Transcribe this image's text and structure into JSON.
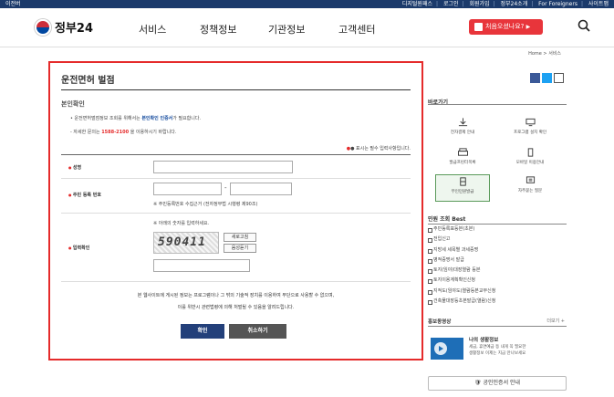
{
  "topbar": {
    "left": "이전버",
    "links": [
      "디지털원패스",
      "로그인",
      "회원가입",
      "정부24소개",
      "For Foreigners",
      "사이트맵"
    ]
  },
  "header": {
    "logo": "정부24",
    "nav": [
      "서비스",
      "정책정보",
      "기관정보",
      "고객센터"
    ],
    "cta": "처음오셨나요?",
    "search_icon": "search-icon"
  },
  "breadcrumb": "Home > 서비스",
  "main": {
    "title": "운전면허 벌점",
    "section": "본인확인",
    "desc1_pre": "운전면허벌점정보 조회를 위해서는 ",
    "desc1_link": "본인확인 인증서",
    "desc1_post": "가 필요합니다.",
    "desc2_pre": "- 자세한 문의는 ",
    "desc2_phone": "1588-2100",
    "desc2_post": " 을 이용하시기 바랍니다.",
    "required_note": "● 표시는 필수 입력사항입니다.",
    "fields": {
      "name_label": "성명",
      "rrn_label": "주민 등록 번호",
      "rrn_hint": "※ 주민등록번호 수집근거 (전자정부법 시행령 제90조)",
      "captcha_label": "입력확인",
      "captcha_hint": "※ 아래의 숫자를 입력하세요.",
      "captcha_text": "590411",
      "refresh_label": "새로고침",
      "audio_label": "음성듣기"
    },
    "notice1": "본 웹사이트에 게시된 정보는 프로그램이나 그 밖의 기술적 장치를 이용하여 무단으로 사용할 수 없으며,",
    "notice2": "이를 위반시 관련법령에 의해 처벌될 수 있음을 알려드립니다.",
    "confirm": "확인",
    "cancel": "취소하기"
  },
  "side": {
    "quick_title": "바로가기",
    "quick": [
      "전자결제 안내",
      "프로그램 설치 확인",
      "발급프린터목록",
      "모바일 이용안내",
      "무인민원발급",
      "자주묻는 질문"
    ],
    "best_title": "민원 조회 Best",
    "best": [
      "주민등록표등본(초본)",
      "전입신고",
      "지방세 세목별 과세증명",
      "병적증명서 발급",
      "토지(임야)대장열람 등본",
      "토지이용계획확인신청",
      "지적도(임야도)열람등본교부신청",
      "건축물대장등초본발급(열람)신청"
    ],
    "video_title": "홍보동영상",
    "video_more": "더보기 +",
    "video_caption1": "나의 생활정보",
    "video_caption2": "세금, 휴면예금 등 내게 꼭 필요한",
    "video_caption3": "생활정보 이제는 지금 만나보세요",
    "cert": "공인인증서 안내"
  }
}
